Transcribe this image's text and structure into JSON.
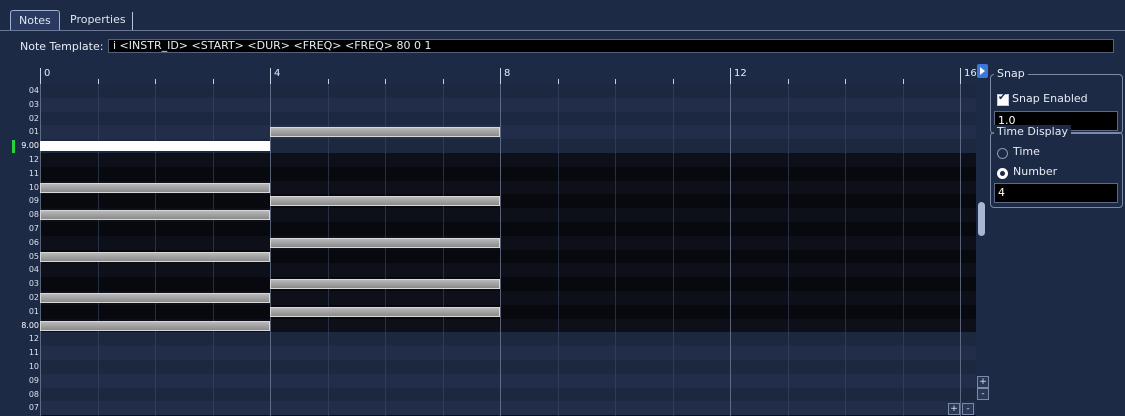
{
  "tabs": [
    {
      "label": "Notes",
      "active": true
    },
    {
      "label": "Properties",
      "active": false
    }
  ],
  "template": {
    "label": "Note Template:",
    "value": "i <INSTR_ID> <START> <DUR> <FREQ> <FREQ> 80 0 1"
  },
  "ruler": {
    "labels": [
      "0",
      "4",
      "8",
      "12",
      "16"
    ]
  },
  "pitch_rows": [
    "04",
    "03",
    "02",
    "01",
    "9.00",
    "12",
    "11",
    "10",
    "09",
    "08",
    "07",
    "06",
    "05",
    "04",
    "03",
    "02",
    "01",
    "8.00",
    "12",
    "11",
    "10",
    "09",
    "08",
    "07"
  ],
  "notes": [
    {
      "row": "01 (oct 9)",
      "start": 4,
      "duration": 4
    },
    {
      "row": "9.00",
      "start": 0,
      "duration": 4,
      "selected": true
    },
    {
      "row": "10 (oct 8)",
      "start": 0,
      "duration": 4
    },
    {
      "row": "09 (oct 8)",
      "start": 4,
      "duration": 4
    },
    {
      "row": "08 (oct 8)",
      "start": 0,
      "duration": 4
    },
    {
      "row": "06 (oct 8)",
      "start": 4,
      "duration": 4
    },
    {
      "row": "05 (oct 8)",
      "start": 0,
      "duration": 4
    },
    {
      "row": "03 (oct 8)",
      "start": 4,
      "duration": 4
    },
    {
      "row": "02 (oct 8)",
      "start": 0,
      "duration": 4
    },
    {
      "row": "01 (oct 8)",
      "start": 4,
      "duration": 4
    },
    {
      "row": "8.00",
      "start": 0,
      "duration": 4
    }
  ],
  "zoom": {
    "plus": "+",
    "minus": "-"
  },
  "snap": {
    "title": "Snap",
    "enabled_label": "Snap Enabled",
    "enabled": true,
    "value": "1.0"
  },
  "time_display": {
    "title": "Time Display",
    "option_time": "Time",
    "option_number": "Number",
    "selected": "Number",
    "value": "4"
  },
  "colors": {
    "background": "#1d2a45",
    "note": "#9a9a9a",
    "selected_note": "#ffffff",
    "cursor": "#27d33a"
  }
}
